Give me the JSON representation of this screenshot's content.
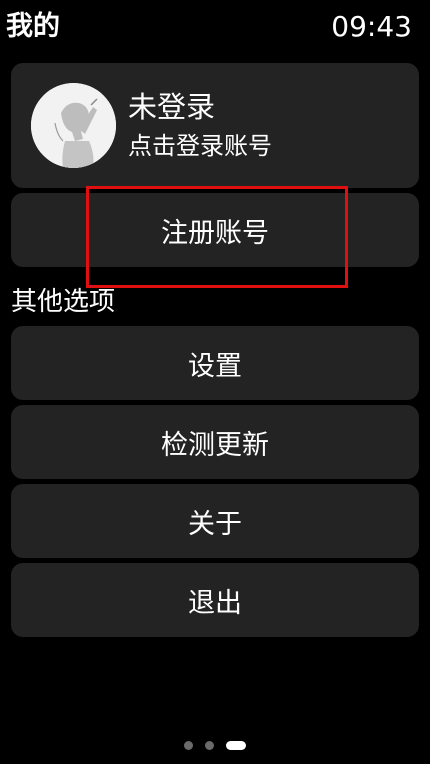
{
  "header": {
    "title": "我的",
    "time": "09:43"
  },
  "profile": {
    "name": "未登录",
    "hint": "点击登录账号",
    "avatar_icon": "avatar-icon"
  },
  "register": {
    "label": "注册账号"
  },
  "other_options": {
    "section_title": "其他选项",
    "items": [
      {
        "label": "设置"
      },
      {
        "label": "检测更新"
      },
      {
        "label": "关于"
      },
      {
        "label": "退出"
      }
    ]
  },
  "pager": {
    "total": 3,
    "active": 3
  },
  "colors": {
    "background": "#000000",
    "card": "#232323",
    "highlight": "#e01010",
    "text": "#ffffff"
  }
}
